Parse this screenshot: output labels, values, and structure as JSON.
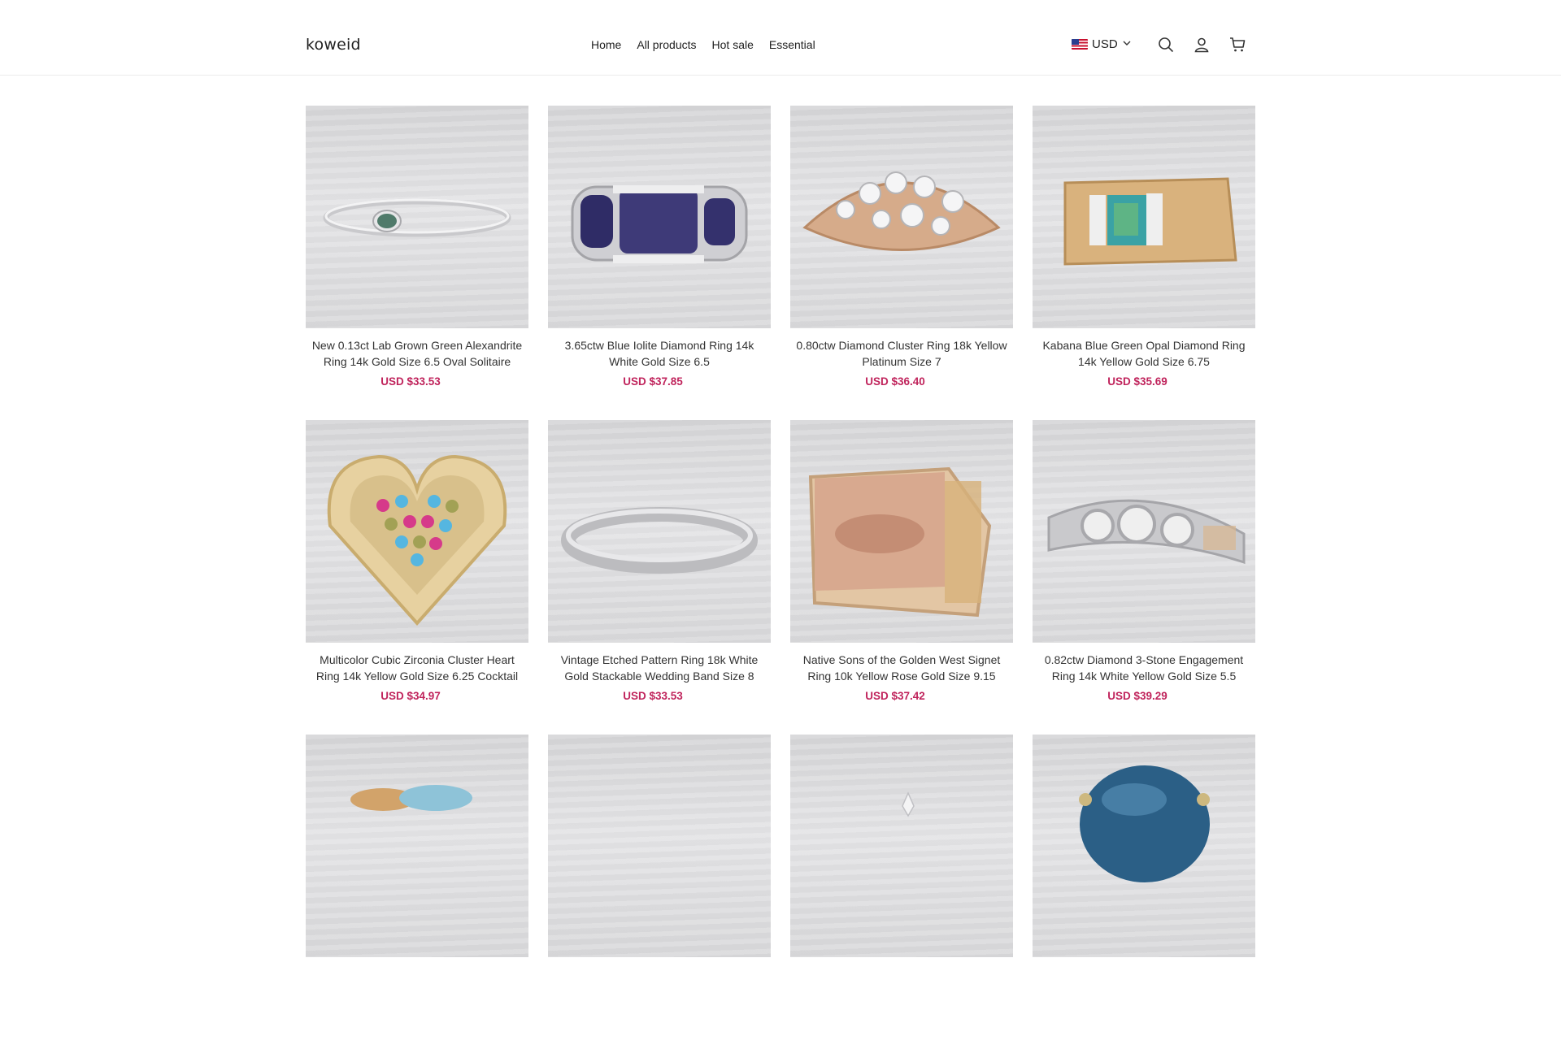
{
  "header": {
    "logo": "koweid",
    "nav": [
      "Home",
      "All products",
      "Hot sale",
      "Essential"
    ],
    "currency": "USD"
  },
  "icons": {
    "flag": "us-flag-icon",
    "chevron": "chevron-down-icon",
    "search": "search-icon",
    "account": "user-icon",
    "cart": "cart-icon"
  },
  "colors": {
    "price": "#c0245c",
    "accent": "#222222"
  },
  "products": [
    {
      "title": "New 0.13ct Lab Grown Green Alexandrite Ring 14k Gold Size 6.5 Oval Solitaire",
      "price": "USD $33.53"
    },
    {
      "title": "3.65ctw Blue Iolite Diamond Ring 14k White Gold Size 6.5",
      "price": "USD $37.85"
    },
    {
      "title": "0.80ctw Diamond Cluster Ring 18k Yellow Platinum Size 7",
      "price": "USD $36.40"
    },
    {
      "title": "Kabana Blue Green Opal Diamond Ring 14k Yellow Gold Size 6.75",
      "price": "USD $35.69"
    },
    {
      "title": "Multicolor Cubic Zirconia Cluster Heart Ring 14k Yellow Gold Size 6.25 Cocktail",
      "price": "USD $34.97"
    },
    {
      "title": "Vintage Etched Pattern Ring 18k White Gold Stackable Wedding Band Size 8",
      "price": "USD $33.53"
    },
    {
      "title": "Native Sons of the Golden West Signet Ring 10k Yellow Rose Gold Size 9.15",
      "price": "USD $37.42"
    },
    {
      "title": "0.82ctw Diamond 3-Stone Engagement Ring 14k White Yellow Gold Size 5.5",
      "price": "USD $39.29"
    },
    {
      "title": "",
      "price": ""
    },
    {
      "title": "",
      "price": ""
    },
    {
      "title": "",
      "price": ""
    },
    {
      "title": "",
      "price": ""
    }
  ]
}
